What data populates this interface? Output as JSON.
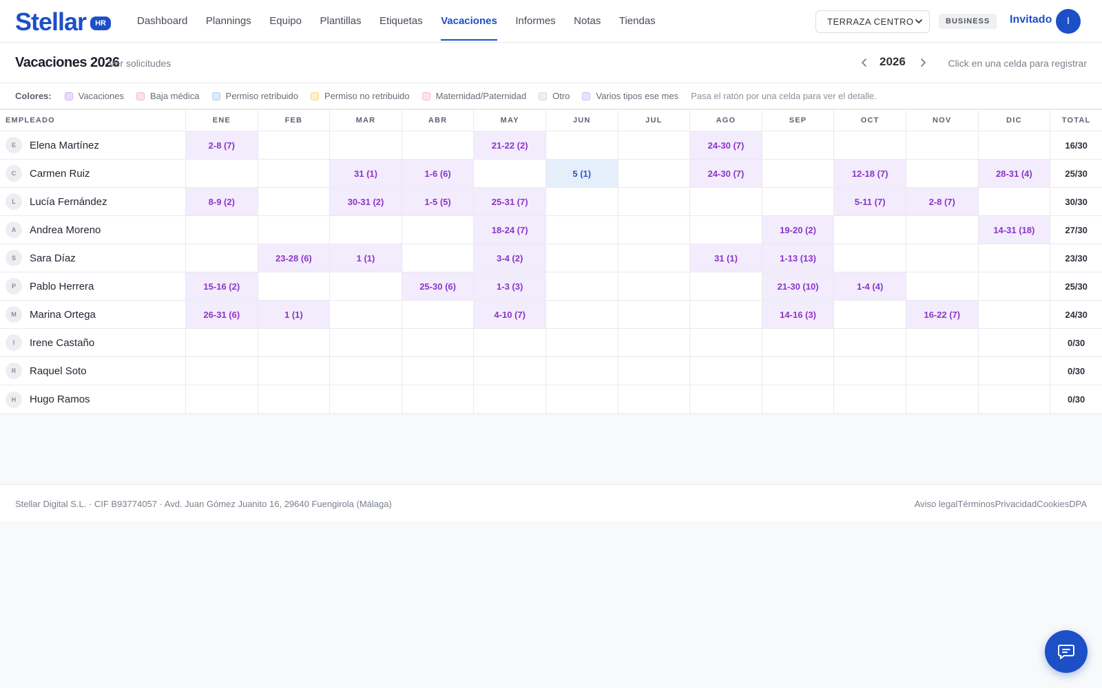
{
  "header": {
    "logo_text": "Stellar",
    "logo_badge": "HR",
    "nav": [
      {
        "label": "Dashboard"
      },
      {
        "label": "Plannings"
      },
      {
        "label": "Equipo"
      },
      {
        "label": "Plantillas"
      },
      {
        "label": "Etiquetas"
      },
      {
        "label": "Vacaciones",
        "active": true
      },
      {
        "label": "Informes"
      },
      {
        "label": "Notas"
      },
      {
        "label": "Tiendas"
      }
    ],
    "store_select": "TERRAZA CENTRO",
    "plan_badge": "BUSINESS",
    "user_name": "Invitado",
    "user_initial": "I"
  },
  "subheader": {
    "title": "Vacaciones 2026",
    "link": "Ver solicitudes",
    "year": "2026",
    "hint": "Click en una celda para registrar"
  },
  "legend": {
    "label": "Colores:",
    "items": [
      {
        "label": "Vacaciones",
        "color": "#e9dcfa",
        "border": "#cdb5f0"
      },
      {
        "label": "Baja médica",
        "color": "#fde1e3",
        "border": "#f2b8bd"
      },
      {
        "label": "Permiso retribuido",
        "color": "#deebfb",
        "border": "#b3cdf0"
      },
      {
        "label": "Permiso no retribuido",
        "color": "#fdf1cc",
        "border": "#f0d98a"
      },
      {
        "label": "Maternidad/Paternidad",
        "color": "#fce4ec",
        "border": "#f2bccd"
      },
      {
        "label": "Otro",
        "color": "#eef0f3",
        "border": "#d6d9de"
      },
      {
        "label": "Varios tipos ese mes",
        "color": "#e6e4fb",
        "border": "#c6c1f0"
      }
    ],
    "hint": "Pasa el ratón por una celda para ver el detalle."
  },
  "table": {
    "headers": [
      "EMPLEADO",
      "ENE",
      "FEB",
      "MAR",
      "ABR",
      "MAY",
      "JUN",
      "JUL",
      "AGO",
      "SEP",
      "OCT",
      "NOV",
      "DIC",
      "TOTAL"
    ],
    "rows": [
      {
        "initial": "E",
        "name": "Elena Martínez",
        "months": [
          "2-8 (7)",
          "",
          "",
          "",
          "21-22 (2)",
          "",
          "",
          "24-30 (7)",
          "",
          "",
          "",
          ""
        ],
        "total": "16/30"
      },
      {
        "initial": "C",
        "name": "Carmen Ruiz",
        "months": [
          "",
          "",
          "31 (1)",
          "1-6 (6)",
          "",
          "5 (1)",
          "",
          "24-30 (7)",
          "",
          "12-18 (7)",
          "",
          "28-31 (4)"
        ],
        "total": "25/30"
      },
      {
        "initial": "L",
        "name": "Lucía Fernández",
        "months": [
          "8-9 (2)",
          "",
          "30-31 (2)",
          "1-5 (5)",
          "25-31 (7)",
          "",
          "",
          "",
          "",
          "5-11 (7)",
          "2-8 (7)",
          ""
        ],
        "total": "30/30"
      },
      {
        "initial": "A",
        "name": "Andrea Moreno",
        "months": [
          "",
          "",
          "",
          "",
          "18-24 (7)",
          "",
          "",
          "",
          "19-20 (2)",
          "",
          "",
          "14-31 (18)"
        ],
        "total": "27/30"
      },
      {
        "initial": "S",
        "name": "Sara Díaz",
        "months": [
          "",
          "23-28 (6)",
          "1 (1)",
          "",
          "3-4 (2)",
          "",
          "",
          "31 (1)",
          "1-13 (13)",
          "",
          "",
          ""
        ],
        "total": "23/30"
      },
      {
        "initial": "P",
        "name": "Pablo Herrera",
        "months": [
          "15-16 (2)",
          "",
          "",
          "25-30 (6)",
          "1-3 (3)",
          "",
          "",
          "",
          "21-30 (10)",
          "1-4 (4)",
          "",
          ""
        ],
        "total": "25/30"
      },
      {
        "initial": "M",
        "name": "Marina Ortega",
        "months": [
          "26-31 (6)",
          "1 (1)",
          "",
          "",
          "4-10 (7)",
          "",
          "",
          "",
          "14-16 (3)",
          "",
          "16-22 (7)",
          ""
        ],
        "total": "24/30"
      },
      {
        "initial": "I",
        "name": "Irene Castaño",
        "months": [
          "",
          "",
          "",
          "",
          "",
          "",
          "",
          "",
          "",
          "",
          "",
          ""
        ],
        "total": "0/30"
      },
      {
        "initial": "R",
        "name": "Raquel Soto",
        "months": [
          "",
          "",
          "",
          "",
          "",
          "",
          "",
          "",
          "",
          "",
          "",
          ""
        ],
        "total": "0/30"
      },
      {
        "initial": "H",
        "name": "Hugo Ramos",
        "months": [
          "",
          "",
          "",
          "",
          "",
          "",
          "",
          "",
          "",
          "",
          "",
          ""
        ],
        "total": "0/30"
      }
    ],
    "cell_types": {
      "permiso": [
        [
          1,
          5
        ]
      ]
    }
  },
  "footer": {
    "company": "Stellar Digital S.L. · CIF B93774057 · Avd. Juan Gómez Juanito 16, 29640 Fuengirola (Málaga)",
    "links": [
      "Aviso legal",
      "Términos",
      "Privacidad",
      "Cookies",
      "DPA"
    ]
  },
  "icons": {
    "chat": "chat-bubble-icon",
    "prev": "chevron-left-icon",
    "next": "chevron-right-icon",
    "dropdown": "chevron-down-icon"
  }
}
